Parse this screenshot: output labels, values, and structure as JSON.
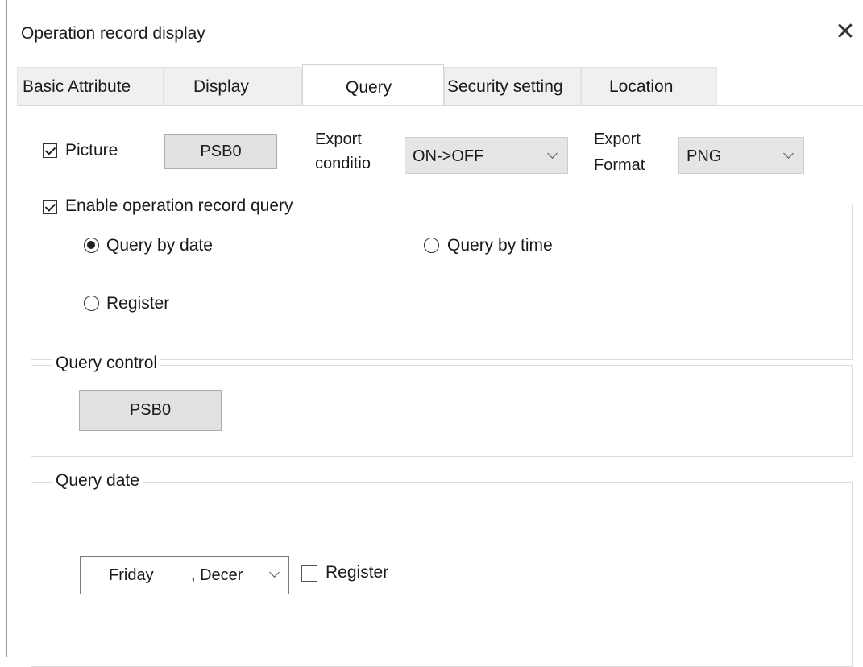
{
  "window": {
    "title": "Operation record display",
    "close_symbol": "✕"
  },
  "tabs": [
    {
      "label": "Basic Attribute",
      "active": false
    },
    {
      "label": "Display",
      "active": false
    },
    {
      "label": "Query",
      "active": true
    },
    {
      "label": "Security setting",
      "active": false
    },
    {
      "label": "Location",
      "active": false
    }
  ],
  "picture": {
    "checked": true,
    "label": "Picture",
    "button_label": "PSB0",
    "export_condition_label_line1": "Export",
    "export_condition_label_line2": "conditio",
    "export_condition_value": "ON->OFF",
    "export_format_label_line1": "Export",
    "export_format_label_line2": "Format",
    "export_format_value": "PNG"
  },
  "enable_query": {
    "checked": true,
    "label": "Enable operation record query",
    "options": [
      {
        "label": "Query by date",
        "selected": true
      },
      {
        "label": "Query by time",
        "selected": false
      },
      {
        "label": "Register",
        "selected": false
      }
    ]
  },
  "query_control": {
    "legend": "Query control",
    "button_label": "PSB0"
  },
  "query_date": {
    "legend": "Query date",
    "date_weekday": "Friday",
    "date_rest": ", Decer",
    "register_checked": false,
    "register_label": "Register"
  }
}
